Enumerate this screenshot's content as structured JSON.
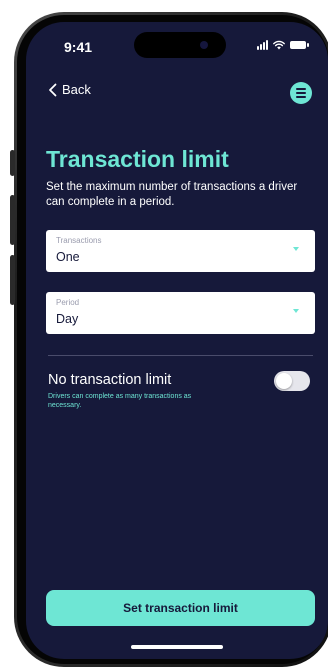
{
  "status_bar": {
    "time": "9:41"
  },
  "nav": {
    "back_label": "Back"
  },
  "page": {
    "title": "Transaction limit",
    "subtitle": "Set the maximum number of transactions a driver can complete in a period."
  },
  "fields": {
    "transactions": {
      "label": "Transactions",
      "value": "One"
    },
    "period": {
      "label": "Period",
      "value": "Day"
    }
  },
  "no_limit": {
    "title": "No transaction limit",
    "description": "Drivers can complete as many transactions as necessary.",
    "enabled": false
  },
  "cta": {
    "label": "Set transaction limit"
  },
  "colors": {
    "accent": "#6ee6d4",
    "background": "#16193a",
    "text": "#ffffff"
  }
}
